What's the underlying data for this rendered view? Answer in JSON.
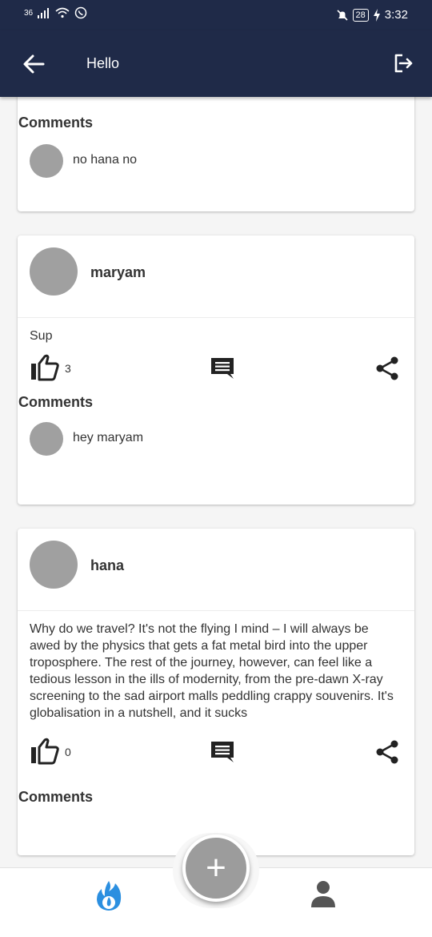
{
  "status_bar": {
    "network": "36",
    "battery": "28",
    "time": "3:32"
  },
  "app_bar": {
    "title": "Hello"
  },
  "posts": [
    {
      "comments_label": "Comments",
      "comments": [
        {
          "text": "no hana no"
        }
      ]
    },
    {
      "author": "maryam",
      "text": "Sup",
      "likes": "3",
      "comments_label": "Comments",
      "comments": [
        {
          "text": "hey maryam"
        }
      ]
    },
    {
      "author": "hana",
      "text": "Why do we travel? It's not the flying I mind – I will always be awed by the physics that gets a fat metal bird into the upper troposphere. The rest of the journey, however, can feel like a tedious lesson in the ills of modernity, from the pre-dawn X-ray screening to the sad airport malls peddling crappy souvenirs. It's globalisation in a nutshell, and it sucks",
      "likes": "0",
      "comments_label": "Comments",
      "comments": []
    }
  ],
  "fab": {
    "icon": "plus-icon",
    "glyph": "+"
  },
  "bottom_nav": {
    "items": [
      {
        "icon": "flame-icon",
        "color": "#2b8fe0"
      },
      {
        "icon": "person-icon",
        "color": "#555555"
      }
    ]
  },
  "colors": {
    "app_bar": "#1f2a48",
    "background": "#f5f5f5",
    "avatar": "#a0a0a0",
    "accent": "#2b8fe0"
  }
}
